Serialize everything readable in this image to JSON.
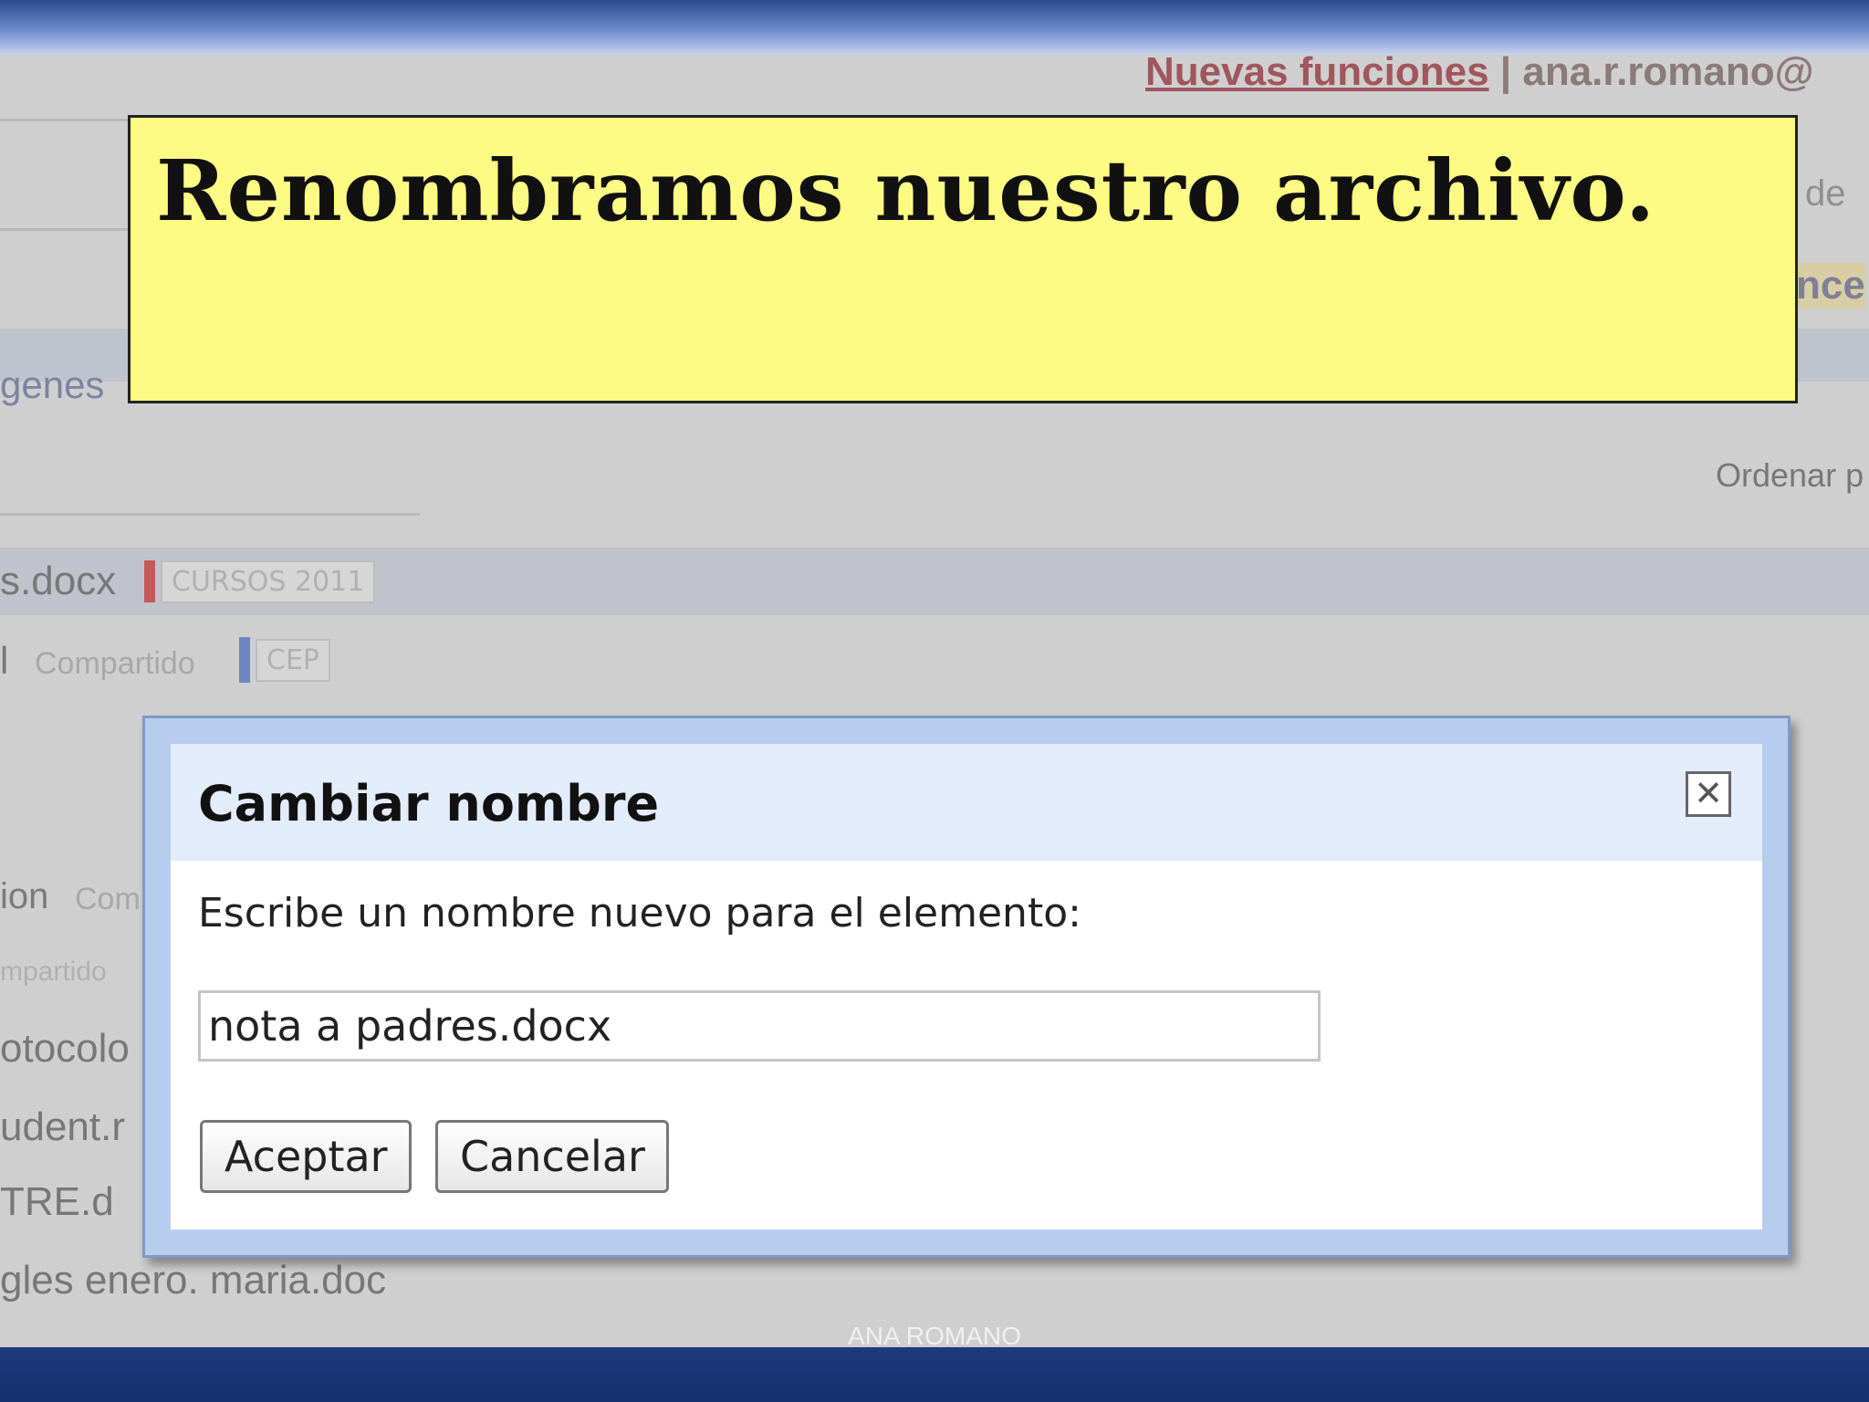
{
  "callout": {
    "text": "Renombramos nuestro archivo."
  },
  "background": {
    "topbar_new_features": "Nuevas funciones",
    "topbar_separator": "|",
    "topbar_user": "ana.r.romano@",
    "right_fragment_1": "de",
    "right_fragment_2": "nce",
    "left_fragment_images": "genes",
    "sort_label": "Ordenar p",
    "file_1_name": "s.docx",
    "file_1_label": "CURSOS 2011",
    "file_2_prefix": "l",
    "file_2_shared": "Compartido",
    "file_2_label": "CEP",
    "list_left_1": "ion",
    "list_left_1_shared": "Com",
    "list_left_2": "mpartido",
    "list_left_3": "otocolo",
    "list_left_4": "udent.r",
    "list_left_5": "TRE.d",
    "list_left_6": "gles enero. maria.doc"
  },
  "dialog": {
    "title": "Cambiar nombre",
    "close_symbol": "✕",
    "prompt": "Escribe un nombre nuevo para el elemento:",
    "input_value": "nota a padres.docx",
    "accept_label": "Aceptar",
    "cancel_label": "Cancelar"
  },
  "footer": {
    "author": "ANA ROMANO"
  },
  "colors": {
    "callout_bg": "#fdfb84",
    "dialog_frame": "#b7cdee",
    "dialog_header": "#e3ecfa",
    "slide_band": "#15306c"
  }
}
